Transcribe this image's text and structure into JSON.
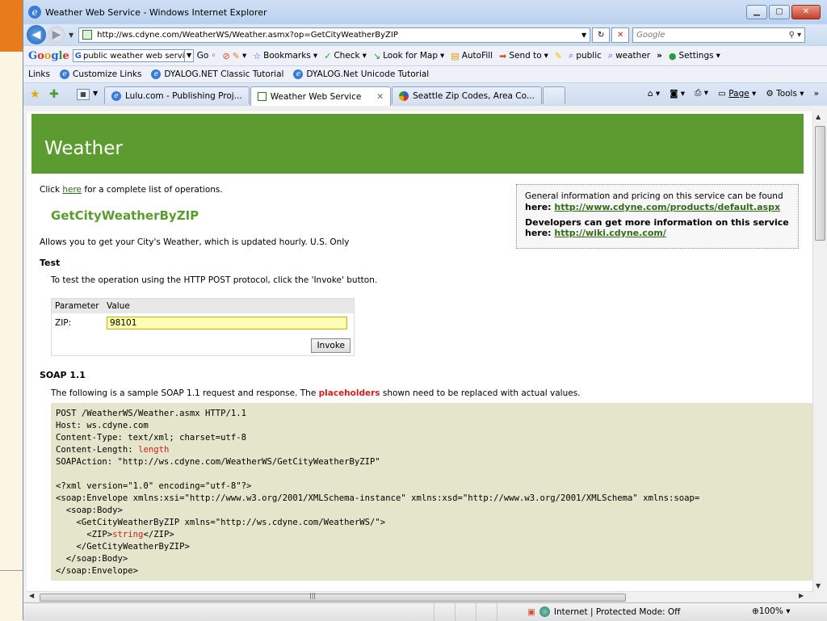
{
  "window": {
    "title": "Weather Web Service - Windows Internet Explorer"
  },
  "address": {
    "url": "http://ws.cdyne.com/WeatherWS/Weather.asmx?op=GetCityWeatherByZIP",
    "search_placeholder": "Google"
  },
  "google_toolbar": {
    "search_value": "public weather web servi",
    "go": "Go",
    "bookmarks": "Bookmarks",
    "check": "Check",
    "look_for_map": "Look for Map",
    "autofill": "AutoFill",
    "send_to": "Send to",
    "public": "public",
    "weather": "weather",
    "more": "»",
    "settings": "Settings"
  },
  "links_bar": {
    "label": "Links",
    "items": [
      "Customize Links",
      "DYALOG.NET Classic Tutorial",
      "DYALOG.Net Unicode Tutorial"
    ]
  },
  "tabs": [
    {
      "label": "Lulu.com - Publishing Proj..."
    },
    {
      "label": "Weather Web Service"
    },
    {
      "label": "Seattle Zip Codes, Area Co..."
    }
  ],
  "command_bar": {
    "page": "Page",
    "tools": "Tools"
  },
  "page": {
    "header": "Weather",
    "intro_prefix": "Click ",
    "intro_link": "here",
    "intro_suffix": " for a complete list of operations.",
    "operation": "GetCityWeatherByZIP",
    "description": "Allows you to get your City's Weather, which is updated hourly. U.S. Only",
    "info": {
      "line1": "General information and pricing on this service can be found",
      "line1_prefix": "here: ",
      "link1": "http://www.cdyne.com/products/default.aspx",
      "line2": "Developers can get more information on this service",
      "line2_prefix": "here: ",
      "link2": "http://wiki.cdyne.com/"
    },
    "test": {
      "heading": "Test",
      "text": "To test the operation using the HTTP POST protocol, click the 'Invoke' button.",
      "col_param": "Parameter",
      "col_value": "Value",
      "param_label": "ZIP:",
      "zip_value": "98101",
      "invoke": "Invoke"
    },
    "soap": {
      "heading": "SOAP 1.1",
      "text_prefix": "The following is a sample SOAP 1.1 request and response. The ",
      "placeholders": "placeholders",
      "text_suffix": " shown need to be replaced with actual values.",
      "lines": [
        "POST /WeatherWS/Weather.asmx HTTP/1.1",
        "Host: ws.cdyne.com",
        "Content-Type: text/xml; charset=utf-8",
        "Content-Length: ",
        "SOAPAction: \"http://ws.cdyne.com/WeatherWS/GetCityWeatherByZIP\"",
        "",
        "<?xml version=\"1.0\" encoding=\"utf-8\"?>",
        "<soap:Envelope xmlns:xsi=\"http://www.w3.org/2001/XMLSchema-instance\" xmlns:xsd=\"http://www.w3.org/2001/XMLSchema\" xmlns:soap=",
        "  <soap:Body>",
        "    <GetCityWeatherByZIP xmlns=\"http://ws.cdyne.com/WeatherWS/\">",
        "      <ZIP>",
        "    </GetCityWeatherByZIP>",
        "  </soap:Body>",
        "</soap:Envelope>"
      ],
      "length_ph": "length",
      "string_ph": "string",
      "zip_close": "</ZIP>"
    }
  },
  "status": {
    "zone": "Internet | Protected Mode: Off",
    "zoom": "100%"
  }
}
